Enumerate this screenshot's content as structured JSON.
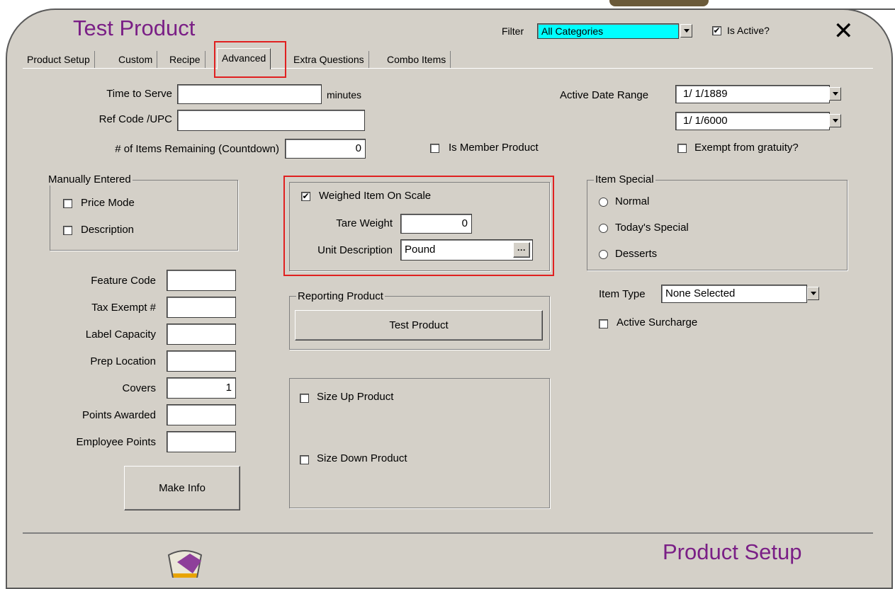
{
  "window": {
    "title": "Test Product",
    "footer_title": "Product Setup"
  },
  "header": {
    "filter_label": "Filter",
    "filter_value": "All Categories",
    "is_active_label": "Is Active?",
    "is_active_checked": true
  },
  "tabs": [
    "Product Setup",
    "Custom",
    "Recipe",
    "Advanced",
    "Extra Questions",
    "Combo Items"
  ],
  "active_tab": "Advanced",
  "fields": {
    "time_to_serve": {
      "label": "Time to Serve",
      "value": "",
      "unit": "minutes"
    },
    "ref_code": {
      "label": "Ref Code /UPC",
      "value": ""
    },
    "items_remaining": {
      "label": "# of Items Remaining (Countdown)",
      "value": "0"
    },
    "is_member": {
      "label": "Is Member Product",
      "checked": false
    },
    "active_date_range": {
      "label": "Active Date Range",
      "start": "1/ 1/1889",
      "end": "1/ 1/6000"
    },
    "exempt_gratuity": {
      "label": "Exempt from gratuity?",
      "checked": false
    }
  },
  "manually_entered": {
    "title": "Manually Entered",
    "price_mode": "Price Mode",
    "description": "Description"
  },
  "scale": {
    "weighed_label": "Weighed Item On Scale",
    "weighed_checked": true,
    "tare_label": "Tare Weight",
    "tare_value": "0",
    "unit_label": "Unit Description",
    "unit_value": "Pound",
    "ellipsis": "···"
  },
  "item_special": {
    "title": "Item Special",
    "options": [
      "Normal",
      "Today's Special",
      "Desserts"
    ]
  },
  "item_type": {
    "label": "Item Type",
    "value": "None Selected"
  },
  "active_surcharge": {
    "label": "Active Surcharge",
    "checked": false
  },
  "left_fields": [
    {
      "label": "Feature Code",
      "value": ""
    },
    {
      "label": "Tax Exempt #",
      "value": ""
    },
    {
      "label": "Label Capacity",
      "value": ""
    },
    {
      "label": "Prep Location",
      "value": ""
    },
    {
      "label": "Covers",
      "value": "1"
    },
    {
      "label": "Points Awarded",
      "value": ""
    },
    {
      "label": "Employee Points",
      "value": ""
    }
  ],
  "reporting_product": {
    "title": "Reporting Product",
    "button": "Test Product"
  },
  "size": {
    "up": "Size Up Product",
    "down": "Size Down Product"
  },
  "make_info": "Make Info",
  "colors": {
    "title": "#7a1f86",
    "filter_bg": "#00ffff",
    "highlight": "#e02020"
  }
}
